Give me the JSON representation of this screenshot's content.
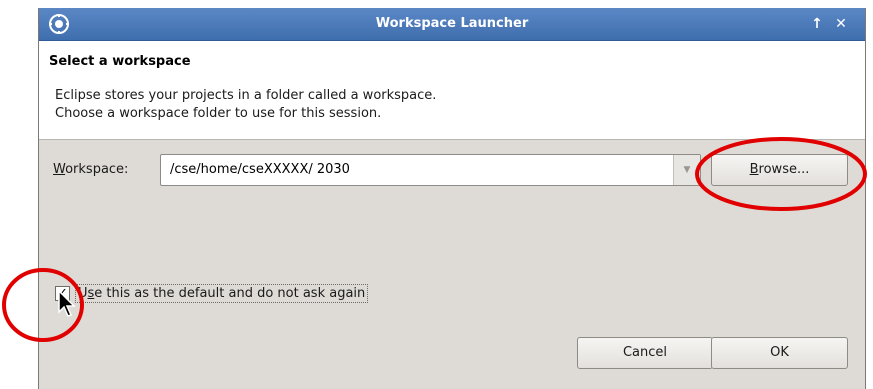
{
  "window": {
    "title": "Workspace Launcher",
    "maximize_glyph": "↑",
    "close_glyph": "✕"
  },
  "header": {
    "title": "Select a workspace",
    "description_line1": "Eclipse stores your projects in a folder called a workspace.",
    "description_line2": "Choose a workspace folder to use for this session."
  },
  "workspace": {
    "label_mnemonic": "W",
    "label_rest": "orkspace:",
    "value": "/cse/home/cseXXXXX/ 2030",
    "dropdown_glyph": "▼"
  },
  "buttons": {
    "browse_mnemonic": "B",
    "browse_rest": "rowse...",
    "cancel": "Cancel",
    "ok": "OK"
  },
  "default_checkbox": {
    "checked": true,
    "check_glyph": "✓",
    "label_first": "U",
    "label_mnemonic": "s",
    "label_rest": "e this as the default and do not ask again"
  },
  "icons": {
    "app": "eclipse-gear-icon",
    "cursor": "mouse-pointer-icon"
  },
  "colors": {
    "titlebar": "#4a7bbd",
    "dialog_bg": "#dedbd6",
    "annotation_circle": "#e00000"
  }
}
